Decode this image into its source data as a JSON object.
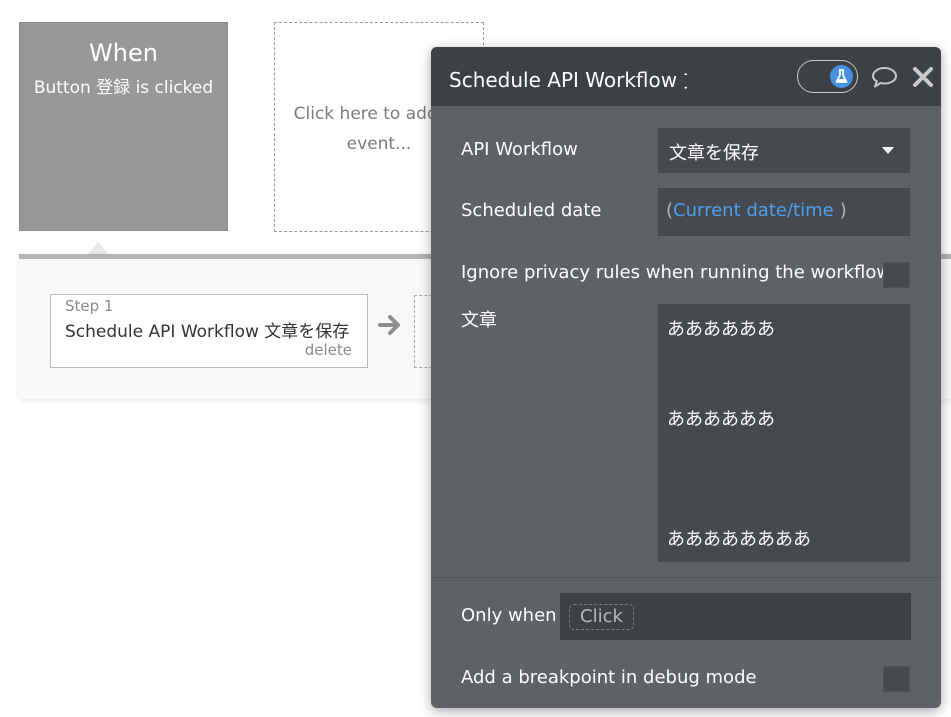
{
  "event": {
    "title": "When",
    "description": "Button 登録 is clicked",
    "add_event_text": "Click here to add an event..."
  },
  "steps": [
    {
      "number_label": "Step 1",
      "name": "Schedule API Workflow 文章を保存",
      "delete_label": "delete"
    }
  ],
  "panel": {
    "title": "Schedule API Workflow 文章を保存",
    "toggle_icon": "flask-icon",
    "fields": {
      "api_workflow_label": "API Workflow",
      "api_workflow_value": "文章を保存",
      "scheduled_date_label": "Scheduled date",
      "scheduled_date_value": "Current date/time",
      "scheduled_date_open": "(",
      "scheduled_date_close": ")",
      "ignore_privacy_label": "Ignore privacy rules when running the workflow",
      "param_label": "文章",
      "param_lines": [
        "ああああああ",
        "ああああああ",
        "ああああああああ"
      ],
      "only_when_label": "Only when",
      "only_when_placeholder": "Click",
      "breakpoint_label": "Add a breakpoint in debug mode"
    }
  },
  "colors": {
    "panel_bg": "#5e6266",
    "header_bg": "#3d4145",
    "field_bg": "#464a4e",
    "dynamic_accent": "#4ea0f1",
    "toggle_knob": "#4a90e2"
  }
}
